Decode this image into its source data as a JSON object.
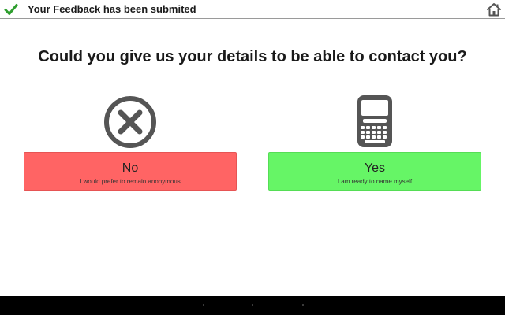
{
  "header": {
    "title": "Your Feedback has been submited",
    "check_icon": "checkmark-icon",
    "home_icon": "home-icon",
    "accent": "#2e9e2e"
  },
  "main": {
    "question": "Could you give us your details to be able to contact you?",
    "options": [
      {
        "label": "No",
        "sublabel": "I would prefer to remain anonymous",
        "icon": "x-circle-icon",
        "color": "#ff6464"
      },
      {
        "label": "Yes",
        "sublabel": "I am ready to name myself",
        "icon": "phone-icon",
        "color": "#66f566"
      }
    ]
  },
  "icon_color": "#555555"
}
